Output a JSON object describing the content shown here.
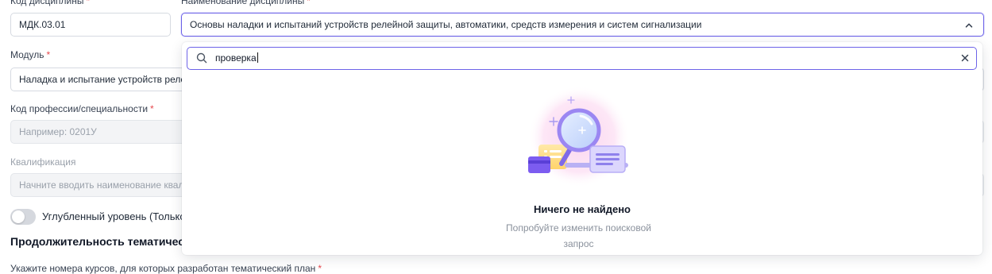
{
  "form": {
    "code_label": "Код дисциплины",
    "code_value": "МДК.03.01",
    "name_label": "Наименование дисциплины",
    "name_value": "Основы наладки и испытаний устройств релейной защиты, автоматики, средств измерения и систем сигнализации",
    "module_label": "Модуль",
    "module_value": "Наладка и испытание устройств релейной защиты",
    "profession_label": "Код профессии/специальности",
    "profession_placeholder": "Например: 0201У",
    "qualification_label": "Квалификация",
    "qualification_placeholder": "Начните вводить наименование квалификации",
    "toggle_label": "Углубленный уровень (Только для СПО)",
    "toggle_on": false,
    "section_title": "Продолжительность тематического плана",
    "courses_label": "Укажите номера курсов, для которых разработан тематический план",
    "required_mark": "*"
  },
  "dropdown": {
    "search_value": "проверка",
    "empty_title": "Ничего не найдено",
    "empty_subtitle": "Попробуйте изменить поисковой запрос"
  },
  "colors": {
    "accent": "#6d63e8",
    "required": "#e5484d"
  },
  "icons": [
    "chevron-up-icon",
    "search-icon",
    "clear-icon",
    "no-results-illustration"
  ]
}
